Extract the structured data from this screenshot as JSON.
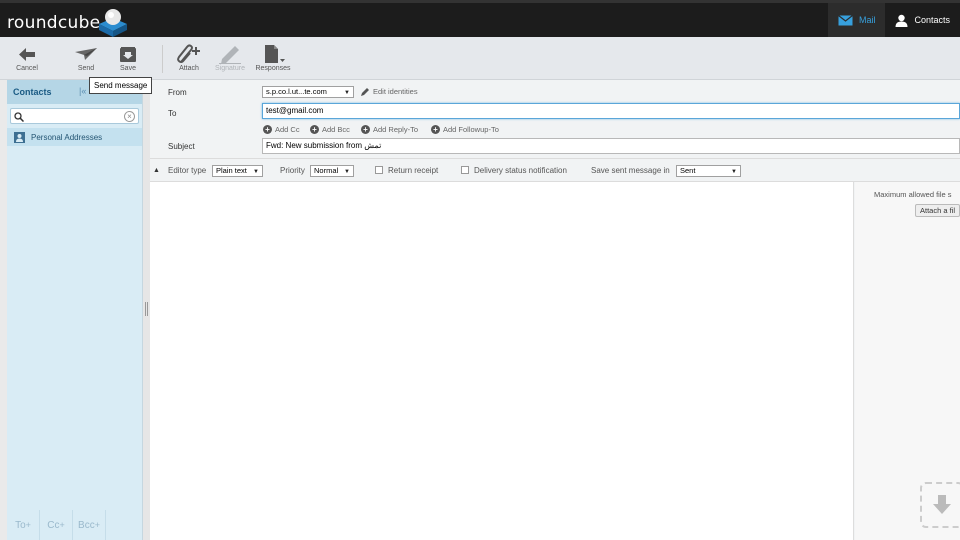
{
  "app": {
    "name": "roundcube"
  },
  "topnav": {
    "mail": "Mail",
    "contacts": "Contacts"
  },
  "toolbar": {
    "cancel": "Cancel",
    "send": "Send",
    "save": "Save",
    "attach": "Attach",
    "signature": "Signature",
    "responses": "Responses",
    "tooltip": "Send message"
  },
  "sidebar": {
    "title": "Contacts",
    "search_value": "",
    "addressbook": "Personal Addresses",
    "footer": [
      "To",
      "Cc",
      "Bcc"
    ]
  },
  "compose": {
    "from_label": "From",
    "from_value": "s.p.co.l.ut...te.com",
    "edit_identities": "Edit identities",
    "to_label": "To",
    "to_value": "test@gmail.com",
    "add_cc": "Add Cc",
    "add_bcc": "Add Bcc",
    "add_reply_to": "Add Reply-To",
    "add_followup_to": "Add Followup-To",
    "subject_label": "Subject",
    "subject_value": "Fwd: New submission from تمش"
  },
  "options": {
    "editor_type_label": "Editor type",
    "editor_type_value": "Plain text",
    "priority_label": "Priority",
    "priority_value": "Normal",
    "return_receipt": "Return receipt",
    "dsn": "Delivery status notification",
    "save_sent_label": "Save sent message in",
    "save_sent_value": "Sent"
  },
  "attachments": {
    "max_size_note": "Maximum allowed file s",
    "attach_button": "Attach a fil"
  },
  "colors": {
    "accent": "#37a0dd",
    "sidebar": "#d9ecf5",
    "topbar": "#1c1c1c"
  },
  "icons": [
    "cancel-icon",
    "send-icon",
    "save-icon",
    "attach-icon",
    "signature-icon",
    "responses-icon",
    "mail-icon",
    "user-icon",
    "search-icon",
    "addressbook-icon",
    "pencil-icon",
    "download-icon"
  ]
}
